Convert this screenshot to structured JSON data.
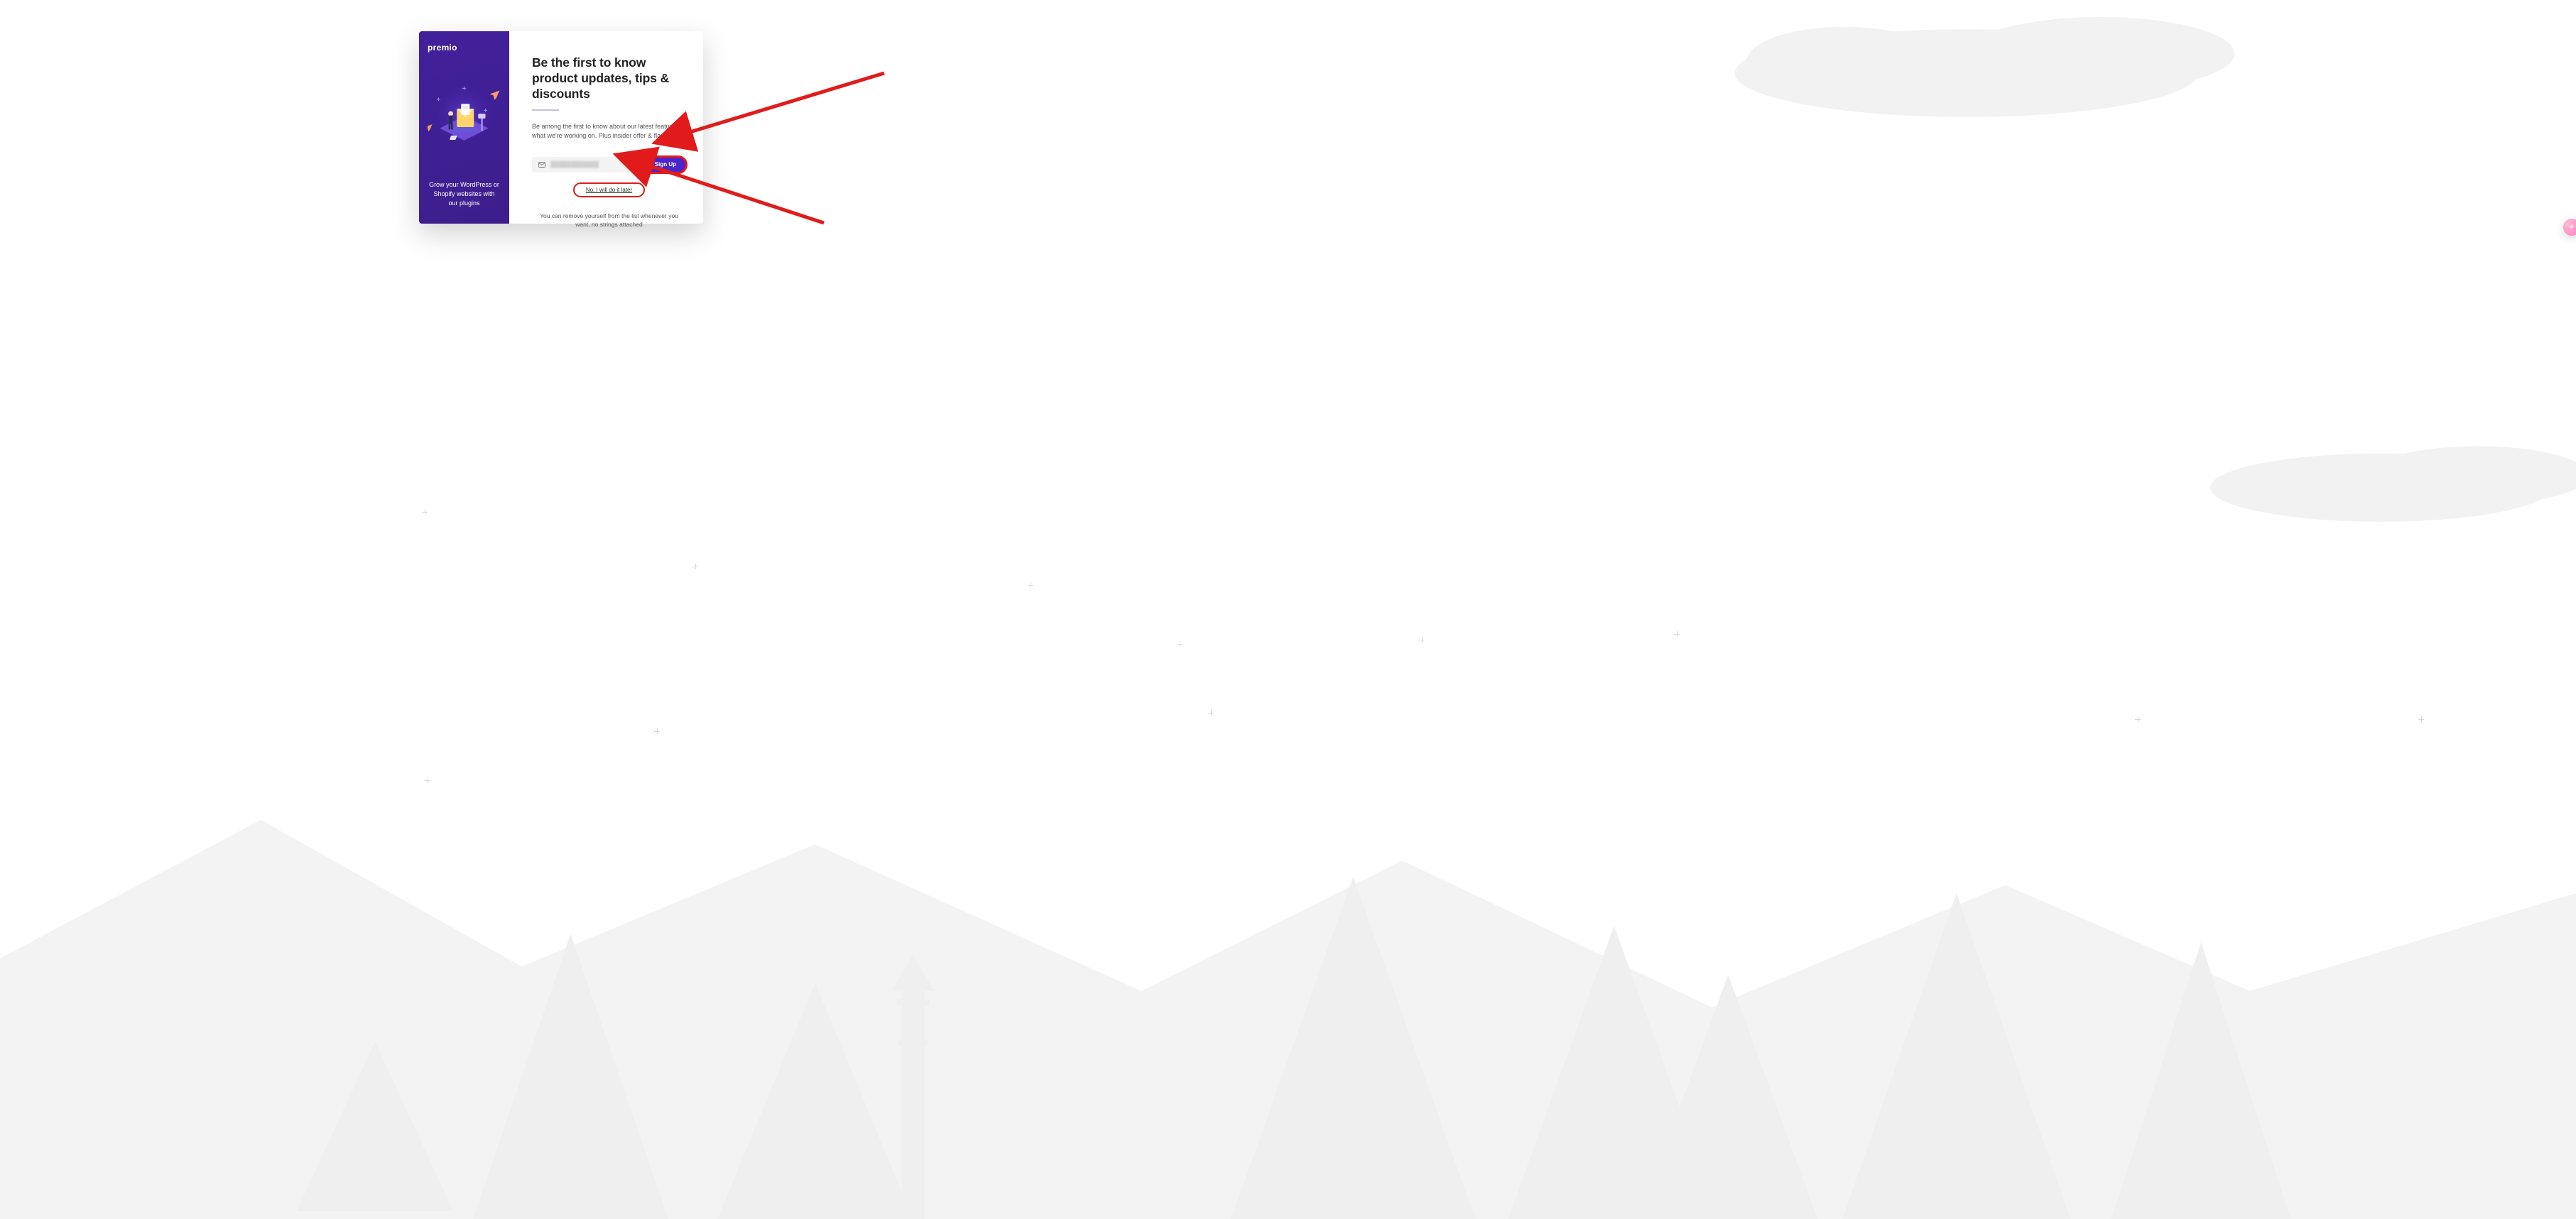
{
  "annotations": {
    "arrow_top": {
      "targets": "signup-button"
    },
    "arrow_bottom": {
      "targets": "skip-link"
    }
  },
  "left_panel": {
    "logo_text": "premio",
    "tagline": "Grow your WordPress or Shopify websites with our plugins"
  },
  "right_panel": {
    "heading": "Be the first to know product updates, tips & discounts",
    "description": "Be among the first to know about our latest features & what we're working on. Plus insider offer & flash sales",
    "email_placeholder": "",
    "email_value_display": "████████████",
    "signup_label": "Sign Up",
    "skip_label": "No, I will do it later",
    "fine_print": "You can remove yourself from the list whenever you want, no strings attached"
  },
  "fab": {
    "glyph": "✦"
  }
}
